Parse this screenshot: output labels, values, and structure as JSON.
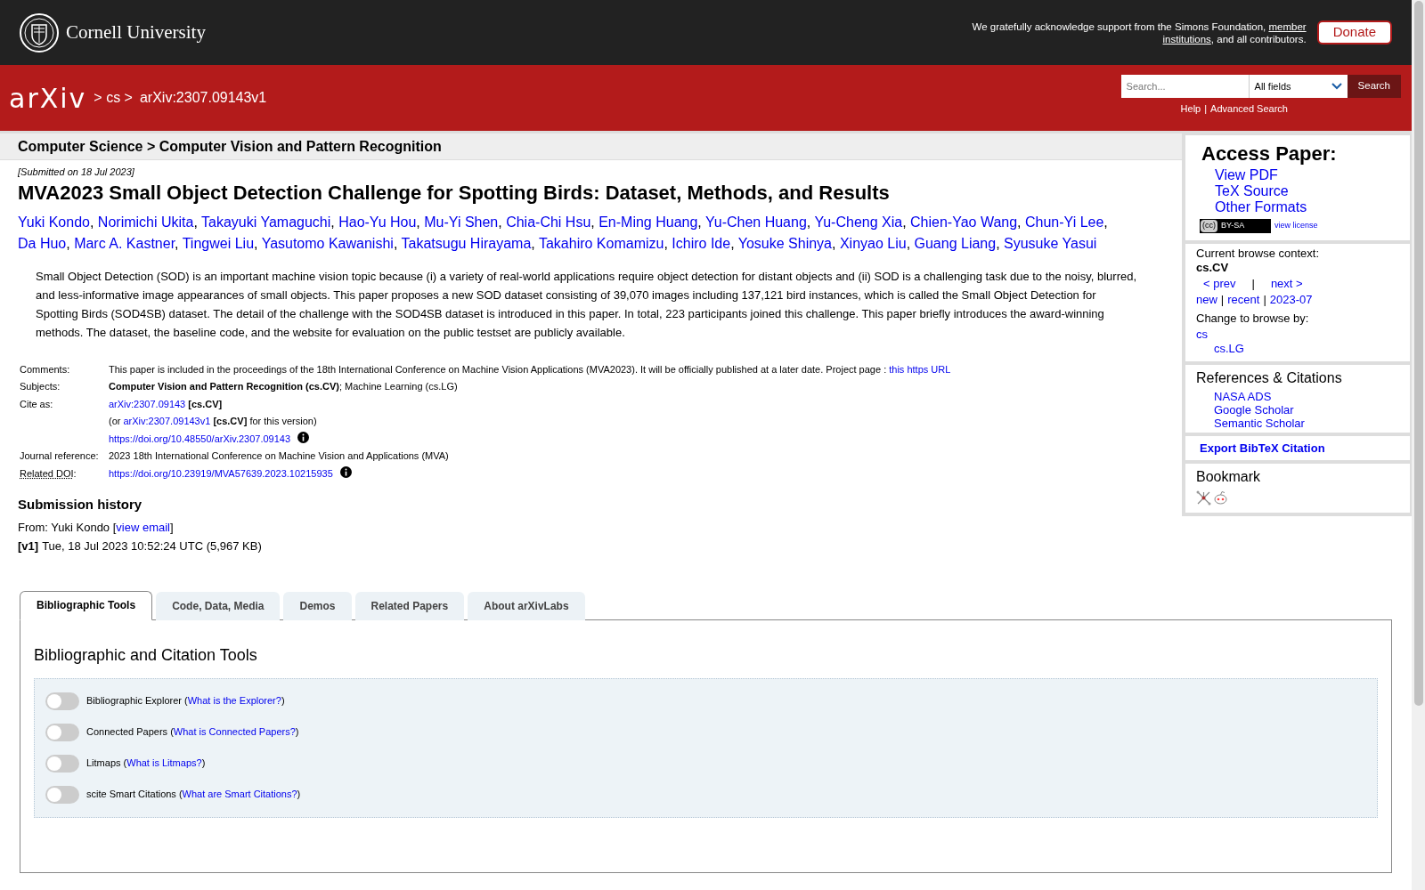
{
  "top_bar": {
    "university": "Cornell University",
    "acknowledgement": [
      [
        {
          "kind": "text",
          "t": "We gratefully acknowledge support from the Simons Foundation, "
        },
        {
          "kind": "ulink",
          "t": "member"
        }
      ],
      [
        {
          "kind": "ulink",
          "t": "institutions"
        },
        {
          "kind": "text",
          "t": ", and all contributors."
        }
      ]
    ],
    "donate": "Donate"
  },
  "header": {
    "logo": "arXiv",
    "breadcrumb": [
      "> cs >",
      "arXiv:2307.09143v1"
    ],
    "search": {
      "placeholder": "Search..."
    },
    "field_select": "All fields",
    "search_button": "Search",
    "help": "Help",
    "separator": "|",
    "advanced": "Advanced Search"
  },
  "subheader": "Computer Science > Computer Vision and Pattern Recognition",
  "submitted": "[Submitted on 18 Jul 2023]",
  "title": "MVA2023 Small Object Detection Challenge for Spotting Birds: Dataset, Methods, and Results",
  "authors": {
    "separator": ",",
    "names": [
      "Yuki Kondo",
      "Norimichi Ukita",
      "Takayuki Yamaguchi",
      "Hao-Yu Hou",
      "Mu-Yi Shen",
      "Chia-Chi Hsu",
      "En-Ming Huang",
      "Yu-Chen Huang",
      "Yu-Cheng Xia",
      "Chien-Yao Wang",
      "Chun-Yi Lee",
      "Da Huo",
      "Marc A. Kastner",
      "Tingwei Liu",
      "Yasutomo Kawanishi",
      "Takatsugu Hirayama",
      "Takahiro Komamizu",
      "Ichiro Ide",
      "Yosuke Shinya",
      "Xinyao Liu",
      "Guang Liang",
      "Syusuke Yasui"
    ]
  },
  "abstract": "Small Object Detection (SOD) is an important machine vision topic because (i) a variety of real-world applications require object detection for distant objects and (ii) SOD is a challenging task due to the noisy, blurred, and less-informative image appearances of small objects. This paper proposes a new SOD dataset consisting of 39,070 images including 137,121 bird instances, which is called the Small Object Detection for Spotting Birds (SOD4SB) dataset. The detail of the challenge with the SOD4SB dataset is introduced in this paper. In total, 223 participants joined this challenge. This paper briefly introduces the award-winning methods. The dataset, the baseline code, and the website for evaluation on the public testset are publicly available.",
  "metadata": [
    {
      "label": "Comments:",
      "underlined": false,
      "lines": [
        {
          "info": false,
          "parts": [
            {
              "kind": "text",
              "t": "This paper is included in the proceedings of the 18th International Conference on Machine Vision Applications (MVA2023). It will be officially published at a later date. Project page : "
            },
            {
              "kind": "link",
              "t": "this https URL"
            }
          ]
        }
      ]
    },
    {
      "label": "Subjects:",
      "underlined": false,
      "lines": [
        {
          "info": false,
          "parts": [
            {
              "kind": "bold",
              "t": "Computer Vision and Pattern Recognition (cs.CV)"
            },
            {
              "kind": "text",
              "t": "; Machine Learning (cs.LG)"
            }
          ]
        }
      ]
    },
    {
      "label": "Cite as:",
      "underlined": false,
      "lines": [
        {
          "info": false,
          "parts": [
            {
              "kind": "link",
              "t": "arXiv:2307.09143"
            },
            {
              "kind": "bold",
              "t": " [cs.CV]"
            }
          ]
        },
        {
          "info": false,
          "parts": [
            {
              "kind": "text",
              "t": "(or "
            },
            {
              "kind": "link",
              "t": "arXiv:2307.09143v1"
            },
            {
              "kind": "bold",
              "t": " [cs.CV]"
            },
            {
              "kind": "text",
              "t": " for this version)"
            }
          ]
        },
        {
          "info": true,
          "parts": [
            {
              "kind": "link",
              "t": "https://doi.org/10.48550/arXiv.2307.09143"
            }
          ]
        }
      ]
    },
    {
      "label": "Journal reference:",
      "underlined": false,
      "lines": [
        {
          "info": false,
          "parts": [
            {
              "kind": "text",
              "t": "2023 18th International Conference on Machine Vision and Applications (MVA)"
            }
          ]
        }
      ]
    },
    {
      "label": "Related DOI",
      "label_suffix": ":",
      "underlined": true,
      "lines": [
        {
          "info": true,
          "parts": [
            {
              "kind": "link",
              "t": "https://doi.org/10.23919/MVA57639.2023.10215935"
            }
          ]
        }
      ]
    }
  ],
  "submission_history": {
    "heading": "Submission history",
    "from": [
      {
        "kind": "text",
        "t": "From: Yuki Kondo ["
      },
      {
        "kind": "link",
        "t": "view email"
      },
      {
        "kind": "text",
        "t": "]"
      }
    ],
    "versions": [
      {
        "version": "[v1]",
        "detail": "Tue, 18 Jul 2023 10:52:24 UTC (5,967 KB)"
      }
    ]
  },
  "tabs": [
    {
      "label": "Bibliographic Tools",
      "selected": true
    },
    {
      "label": "Code, Data, Media",
      "selected": false
    },
    {
      "label": "Demos",
      "selected": false
    },
    {
      "label": "Related Papers",
      "selected": false
    },
    {
      "label": "About arXivLabs",
      "selected": false
    }
  ],
  "tools": {
    "heading": "Bibliographic and Citation Tools",
    "items": [
      {
        "on": false,
        "parts": [
          {
            "kind": "text",
            "t": "Bibliographic Explorer ("
          },
          {
            "kind": "link",
            "t": "What is the Explorer?"
          },
          {
            "kind": "text",
            "t": ")"
          }
        ]
      },
      {
        "on": false,
        "parts": [
          {
            "kind": "text",
            "t": "Connected Papers ("
          },
          {
            "kind": "link",
            "t": "What is Connected Papers?"
          },
          {
            "kind": "text",
            "t": ")"
          }
        ]
      },
      {
        "on": false,
        "parts": [
          {
            "kind": "text",
            "t": "Litmaps ("
          },
          {
            "kind": "link",
            "t": "What is Litmaps?"
          },
          {
            "kind": "text",
            "t": ")"
          }
        ]
      },
      {
        "on": false,
        "parts": [
          {
            "kind": "text",
            "t": "scite Smart Citations ("
          },
          {
            "kind": "link",
            "t": "What are Smart Citations?"
          },
          {
            "kind": "text",
            "t": ")"
          }
        ]
      }
    ]
  },
  "sidebar": {
    "access": {
      "heading": "Access Paper:",
      "links": [
        "View PDF",
        "TeX Source",
        "Other Formats"
      ],
      "license_badge": [
        "(cc)",
        "BY-SA"
      ],
      "license_link": "view license"
    },
    "browse": {
      "label": "Current browse context:",
      "context": "cs.CV",
      "prev": "< prev",
      "bar": "|",
      "next": "next >",
      "links": [
        "new",
        "recent",
        "2023-07"
      ],
      "change_label": "Change to browse by:",
      "categories": [
        {
          "name": "cs",
          "children": [
            {
              "name": "cs.LG"
            }
          ]
        }
      ]
    },
    "references": {
      "heading": "References & Citations",
      "links": [
        "NASA ADS",
        "Google Scholar",
        "Semantic Scholar"
      ]
    },
    "export": "Export BibTeX Citation",
    "bookmark": {
      "heading": "Bookmark"
    }
  }
}
